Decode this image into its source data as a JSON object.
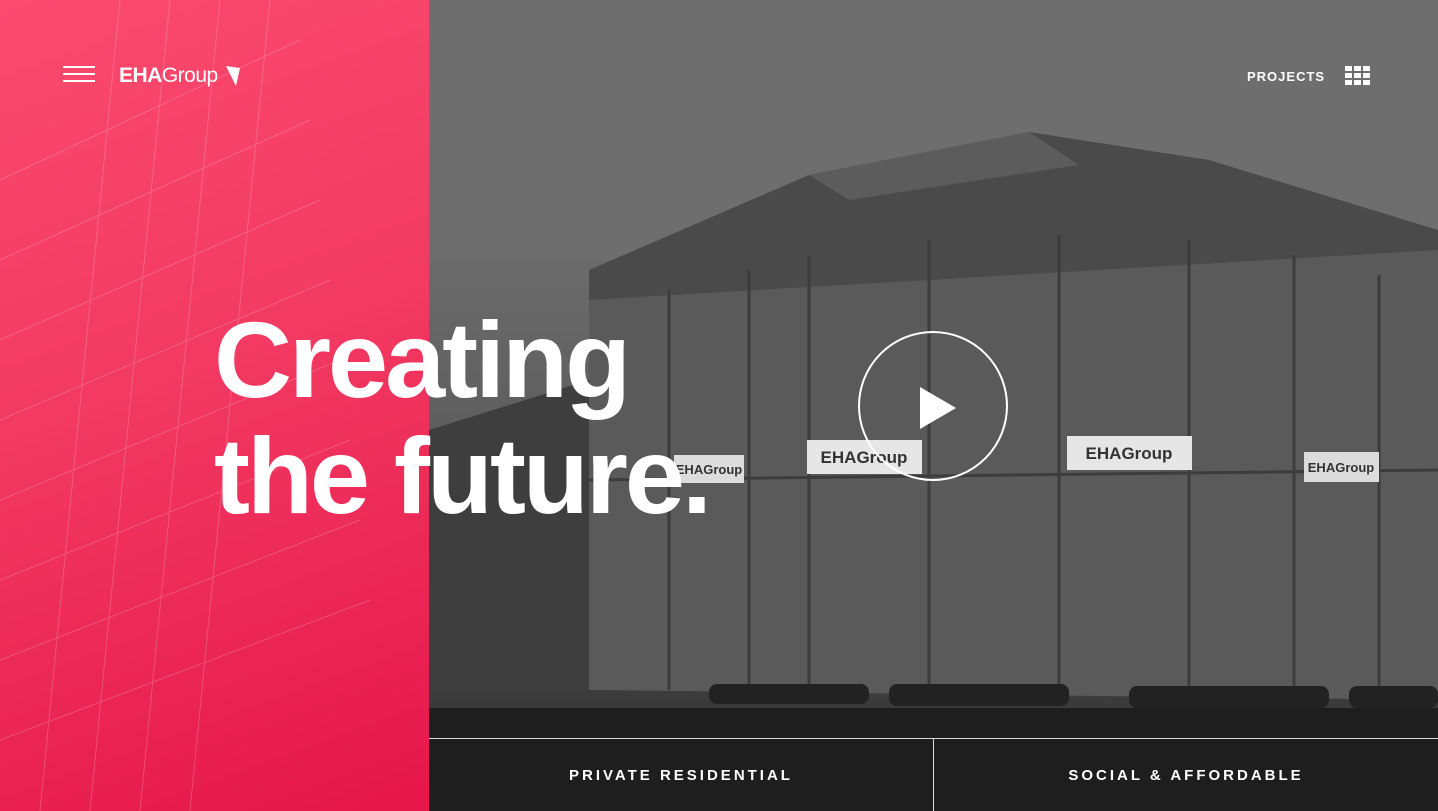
{
  "header": {
    "logo_bold": "EHA",
    "logo_light": "Group",
    "projects_label": "PROJECTS"
  },
  "hero": {
    "line1": "Creating",
    "line2": "the future."
  },
  "building_signs": [
    "EHAGroup",
    "EHAGroup",
    "EHAGroup",
    "EHAGroup"
  ],
  "tabs": [
    {
      "label": "PRIVATE RESIDENTIAL"
    },
    {
      "label": "SOCIAL & AFFORDABLE"
    }
  ],
  "colors": {
    "brand_pink": "#f23a62",
    "brand_pink_dark": "#e5164a"
  }
}
